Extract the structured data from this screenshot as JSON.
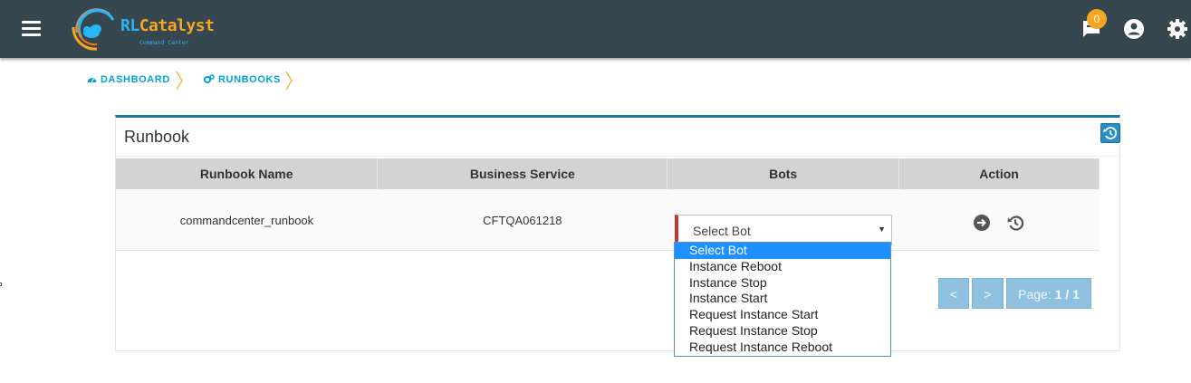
{
  "header": {
    "logo_main": "RL",
    "logo_accent": "Catalyst",
    "logo_sub": "Command Center",
    "notification_count": "0"
  },
  "breadcrumbs": [
    {
      "label": "DASHBOARD"
    },
    {
      "label": "RUNBOOKS"
    }
  ],
  "panel": {
    "title": "Runbook"
  },
  "table": {
    "headers": [
      "Runbook Name",
      "Business Service",
      "Bots",
      "Action"
    ],
    "rows": [
      {
        "runbook_name": "commandcenter_runbook",
        "business_service": "CFTQA061218",
        "bot_selected": "Select Bot"
      }
    ]
  },
  "bot_options": [
    "Select Bot",
    "Instance Reboot",
    "Instance Stop",
    "Instance Start",
    "Request Instance Start",
    "Request Instance Stop",
    "Request Instance Reboot"
  ],
  "pagination": {
    "prev": "<",
    "next": ">",
    "page_prefix": "Page: ",
    "page_value": "1 / 1"
  },
  "colors": {
    "topbar": "#37474f",
    "accent_blue": "#00a3d3",
    "panel_border": "#1e76a6",
    "badge": "#f5a623",
    "select_marker": "#c0392b",
    "pager": "#8fc1de"
  },
  "icons": [
    "menu-icon",
    "notification-icon",
    "account-icon",
    "settings-icon",
    "dashboard-icon",
    "runbooks-icon",
    "history-icon",
    "run-arrow-icon"
  ]
}
